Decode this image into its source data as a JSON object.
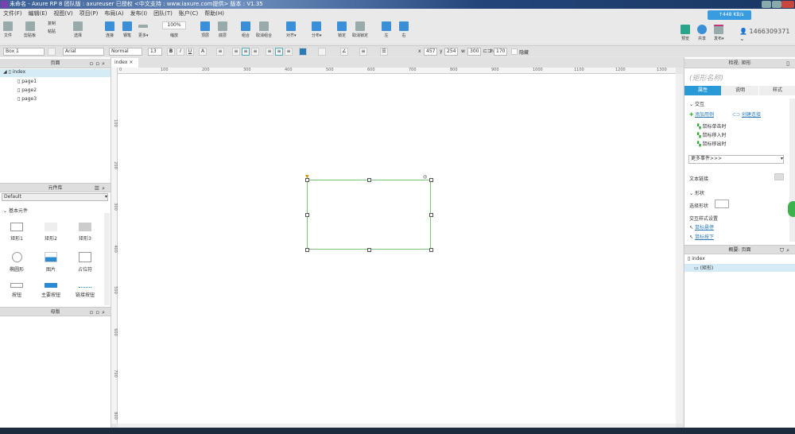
{
  "window": {
    "title": "未命名 - Axure RP 8 团队版 : axureuser 已授权    <中文支持 : www.iaxure.com提供> 版本 : V1.35"
  },
  "menu": [
    "文件(F)",
    "编辑(E)",
    "视图(V)",
    "项目(P)",
    "布局(A)",
    "发布(I)",
    "团队(T)",
    "账户(C)",
    "帮助(H)"
  ],
  "toolbar": {
    "file": "文件",
    "clipboard": "剪贴板",
    "copy": "复制",
    "paste": "粘贴",
    "select": "选择",
    "connect": "连接",
    "pen": "钢笔",
    "more": "更多▾",
    "zoom_value": "100%",
    "zoom": "缩放",
    "top": "顶层",
    "bottom": "底层",
    "group": "组合",
    "ungroup": "取消组合",
    "align": "对齐▾",
    "distribute": "分布▾",
    "lock": "锁定",
    "unlock": "取消锁定",
    "left": "左",
    "right": "右",
    "preview": "预览",
    "share": "共享",
    "publish": "发布▾",
    "speed": "↑448 KB/s",
    "user": "1466309371"
  },
  "format": {
    "widget_name": "Box 1",
    "font": "Arial",
    "style": "Normal",
    "size": "13",
    "x_label": "x",
    "x": "457",
    "y_label": "y",
    "y": "254",
    "w_label": "w",
    "w": "300",
    "h_label": "h",
    "h": "170",
    "hidden": "隐藏"
  },
  "pages": {
    "title": "页面",
    "root": "index",
    "items": [
      "page1",
      "page2",
      "page3"
    ]
  },
  "library": {
    "title": "元件库",
    "selected": "Default",
    "group": "基本元件",
    "widgets": [
      "矩形1",
      "矩形2",
      "矩形3",
      "椭圆形",
      "图片",
      "占位符",
      "按钮",
      "主要按钮",
      "链接按钮"
    ]
  },
  "masters": {
    "title": "母版"
  },
  "canvas": {
    "tab": "index",
    "ruler_x": [
      "0",
      "100",
      "200",
      "300",
      "400",
      "500",
      "600",
      "700",
      "800",
      "900",
      "1000",
      "1100",
      "1200",
      "1300"
    ],
    "ruler_y": [
      "100",
      "200",
      "300",
      "400",
      "500",
      "600",
      "700",
      "800"
    ]
  },
  "inspector": {
    "title": "检视: 矩形",
    "name_placeholder": "(矩形名称)",
    "tabs": [
      "属性",
      "说明",
      "样式"
    ],
    "interaction": "交互",
    "add_case": "添加用例",
    "create_link": "创建连接",
    "events": [
      "鼠标单击时",
      "鼠标移入时",
      "鼠标移出时"
    ],
    "more_events": "更多事件>>>",
    "text_link": "文本链接",
    "shape": "形状",
    "select_shape": "选择形状",
    "interaction_styles": "交互样式设置",
    "hover": "鼠标悬停",
    "mousedown": "鼠标按下"
  },
  "outline": {
    "title": "概要: 页面",
    "root": "index",
    "item": "(矩形)"
  }
}
